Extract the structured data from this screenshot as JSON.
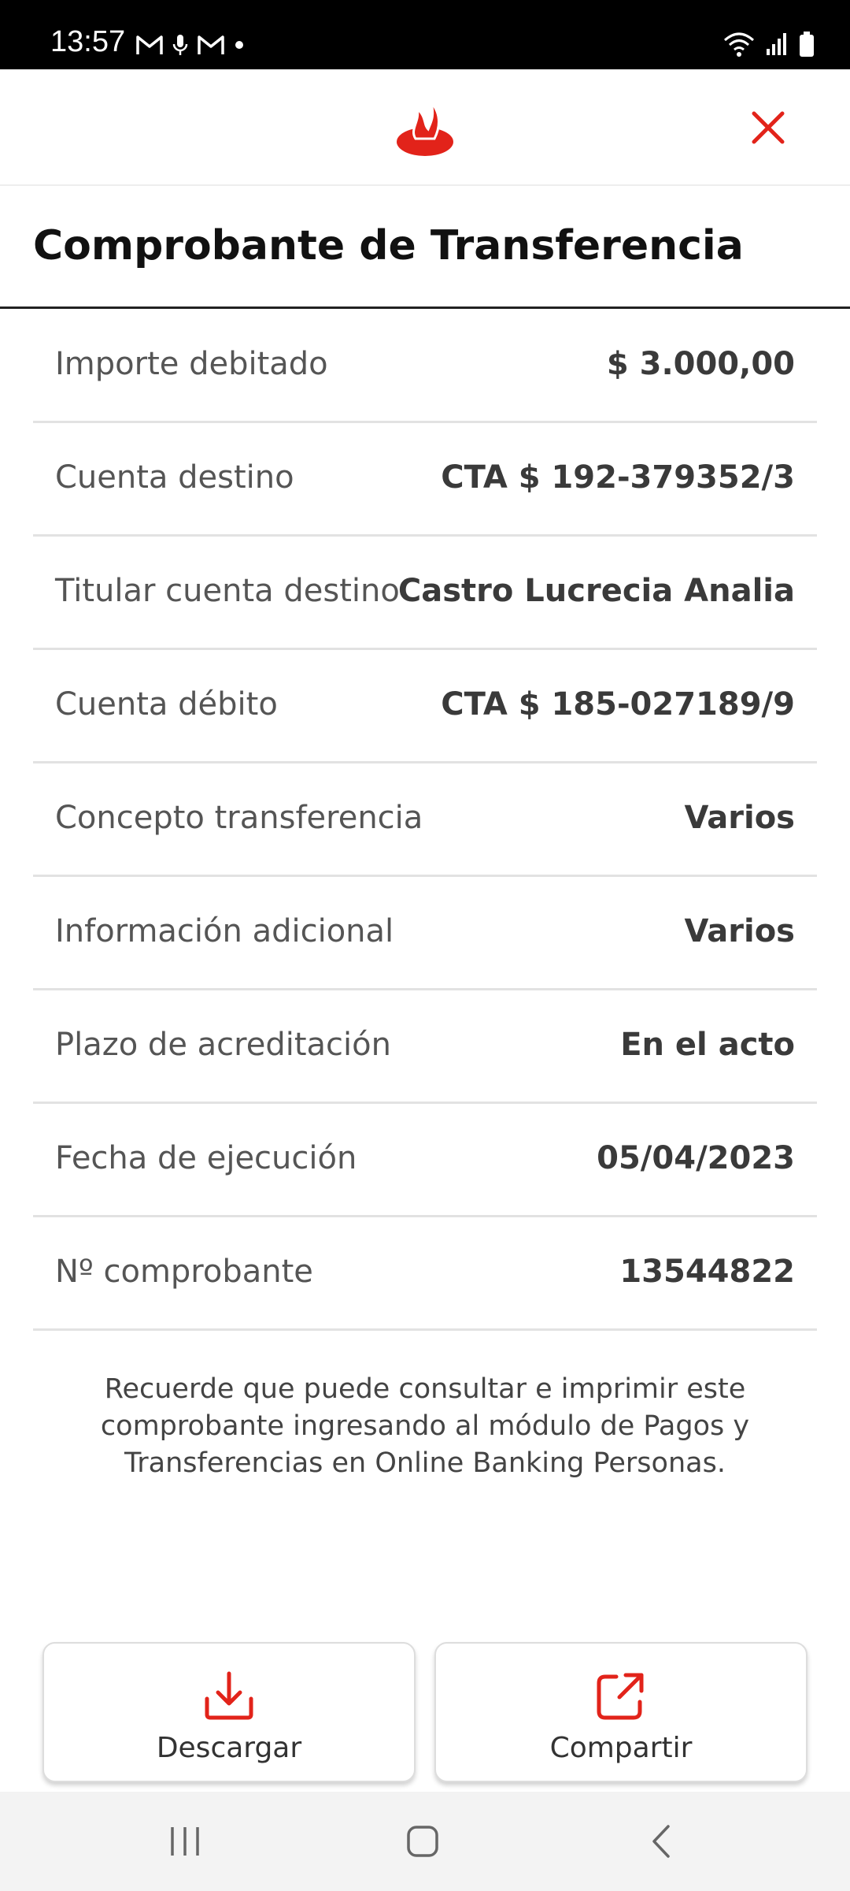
{
  "status_bar": {
    "time": "13:57",
    "left_icons": [
      "gmail-icon",
      "mic-icon",
      "gmail-icon",
      "dot-icon"
    ],
    "right_icons": [
      "wifi-icon",
      "signal-icon",
      "battery-icon"
    ]
  },
  "header": {
    "logo_icon": "santander-flame-icon",
    "close_icon": "close-icon",
    "accent_color": "#e2231a"
  },
  "page": {
    "title": "Comprobante de Transferencia"
  },
  "details": [
    {
      "label": "Importe debitado",
      "value": "$ 3.000,00"
    },
    {
      "label": "Cuenta destino",
      "value": "CTA $ 192-379352/3"
    },
    {
      "label": "Titular cuenta destino",
      "value": "Castro Lucrecia Analia"
    },
    {
      "label": "Cuenta débito",
      "value": "CTA $ 185-027189/9"
    },
    {
      "label": "Concepto transferencia",
      "value": "Varios"
    },
    {
      "label": "Información adicional",
      "value": "Varios"
    },
    {
      "label": "Plazo de acreditación",
      "value": "En el acto"
    },
    {
      "label": "Fecha de ejecución",
      "value": "05/04/2023"
    },
    {
      "label": "Nº comprobante",
      "value": "13544822"
    }
  ],
  "footnote": "Recuerde que puede consultar e imprimir este comprobante ingresando al módulo de Pagos y Transferencias en Online Banking Personas.",
  "actions": {
    "download_label": "Descargar",
    "share_label": "Compartir"
  },
  "nav_bar": {
    "icons": [
      "recents-icon",
      "home-icon",
      "back-icon"
    ]
  }
}
